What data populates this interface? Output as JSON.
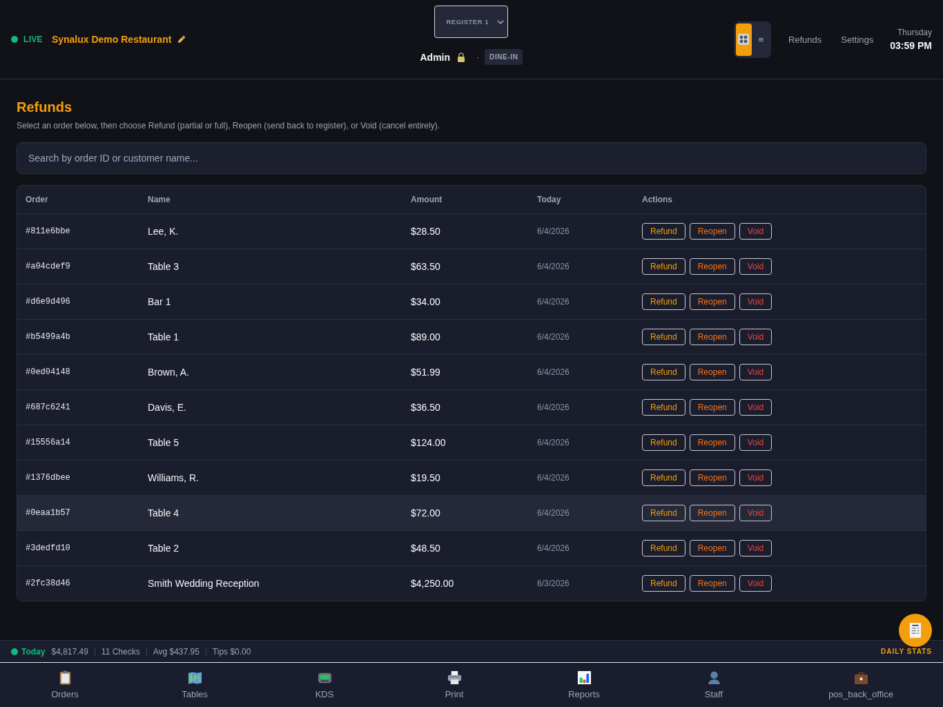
{
  "header": {
    "status": {
      "label": "LIVE"
    },
    "restaurant_name": "Synalux Demo Restaurant",
    "register_select": {
      "value": "REGISTER 1"
    },
    "user": {
      "name": "Admin",
      "separator": "·",
      "order_type": "DINE-IN"
    },
    "view_toggle": [
      {
        "kind": "grid",
        "selected": true
      },
      {
        "kind": "list",
        "label": "≡",
        "selected": false
      }
    ],
    "links": [
      "Refunds",
      "Settings"
    ],
    "clock": {
      "day": "Thursday",
      "time": "03:59 PM"
    }
  },
  "page": {
    "title": "Refunds",
    "subtitle": "Select an order below, then choose Refund (partial or full), Reopen (send back to register), or Void (cancel entirely).",
    "search": {
      "placeholder": "Search by order ID or customer name..."
    }
  },
  "table": {
    "columns": [
      "Order",
      "Name",
      "Amount",
      "Today",
      "Actions"
    ],
    "rows": [
      {
        "order": "#811e6bbe",
        "name": "Lee, K.",
        "amount": "$28.50",
        "date": "6/4/2026",
        "actions": [
          "Refund",
          "Reopen",
          "Void"
        ],
        "selected": false
      },
      {
        "order": "#a04cdef9",
        "name": "Table 3",
        "amount": "$63.50",
        "date": "6/4/2026",
        "actions": [
          "Refund",
          "Reopen",
          "Void"
        ],
        "selected": false
      },
      {
        "order": "#d6e9d496",
        "name": "Bar 1",
        "amount": "$34.00",
        "date": "6/4/2026",
        "actions": [
          "Refund",
          "Reopen",
          "Void"
        ],
        "selected": false
      },
      {
        "order": "#b5499a4b",
        "name": "Table 1",
        "amount": "$89.00",
        "date": "6/4/2026",
        "actions": [
          "Refund",
          "Reopen",
          "Void"
        ],
        "selected": false
      },
      {
        "order": "#0ed04148",
        "name": "Brown, A.",
        "amount": "$51.99",
        "date": "6/4/2026",
        "actions": [
          "Refund",
          "Reopen",
          "Void"
        ],
        "selected": false
      },
      {
        "order": "#687c6241",
        "name": "Davis, E.",
        "amount": "$36.50",
        "date": "6/4/2026",
        "actions": [
          "Refund",
          "Reopen",
          "Void"
        ],
        "selected": false
      },
      {
        "order": "#15556a14",
        "name": "Table 5",
        "amount": "$124.00",
        "date": "6/4/2026",
        "actions": [
          "Refund",
          "Reopen",
          "Void"
        ],
        "selected": false
      },
      {
        "order": "#1376dbee",
        "name": "Williams, R.",
        "amount": "$19.50",
        "date": "6/4/2026",
        "actions": [
          "Refund",
          "Reopen",
          "Void"
        ],
        "selected": false
      },
      {
        "order": "#0eaa1b57",
        "name": "Table 4",
        "amount": "$72.00",
        "date": "6/4/2026",
        "actions": [
          "Refund",
          "Reopen",
          "Void"
        ],
        "selected": true
      },
      {
        "order": "#3dedfd10",
        "name": "Table 2",
        "amount": "$48.50",
        "date": "6/4/2026",
        "actions": [
          "Refund",
          "Reopen",
          "Void"
        ],
        "selected": false
      },
      {
        "order": "#2fc38d46",
        "name": "Smith Wedding Reception",
        "amount": "$4,250.00",
        "date": "6/3/2026",
        "actions": [
          "Refund",
          "Reopen",
          "Void"
        ],
        "selected": false
      }
    ]
  },
  "status_bar": {
    "label": "Today",
    "stats": [
      "$4,817.49",
      "11 Checks",
      "Avg $437.95",
      "Tips $0.00"
    ],
    "daily_stats_label": "DAILY STATS"
  },
  "nav": [
    {
      "label": "Orders"
    },
    {
      "label": "Tables"
    },
    {
      "label": "KDS"
    },
    {
      "label": "Print"
    },
    {
      "label": "Reports"
    },
    {
      "label": "Staff"
    },
    {
      "label": "pos_back_office"
    }
  ]
}
